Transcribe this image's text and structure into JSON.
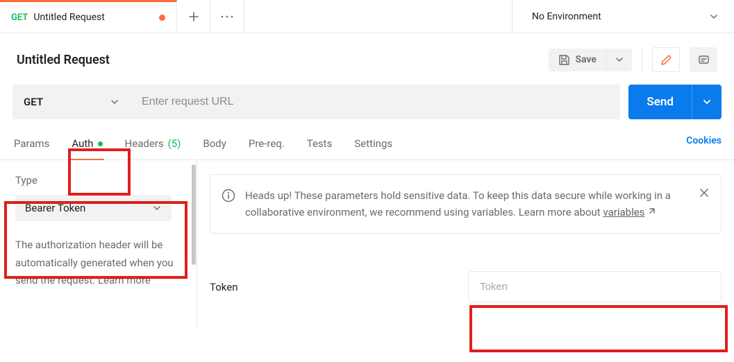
{
  "topbar": {
    "tab": {
      "method": "GET",
      "name": "Untitled Request"
    },
    "env": "No Environment"
  },
  "header": {
    "title": "Untitled Request",
    "save_label": "Save"
  },
  "urlbar": {
    "method": "GET",
    "url_placeholder": "Enter request URL",
    "send_label": "Send"
  },
  "tabs": {
    "params": "Params",
    "auth": "Auth",
    "headers": "Headers",
    "headers_count": "(5)",
    "body": "Body",
    "prereq": "Pre-req.",
    "tests": "Tests",
    "settings": "Settings",
    "cookies": "Cookies"
  },
  "sidebar": {
    "type_label": "Type",
    "type_value": "Bearer Token",
    "auth_desc": "The authorization header will be automatically generated when you send the request. Learn more"
  },
  "banner": {
    "text": "Heads up! These parameters hold sensitive data. To keep this data secure while working in a collaborative environment, we recommend using variables. Learn more about ",
    "link_text": "variables"
  },
  "token": {
    "label": "Token",
    "placeholder": "Token"
  }
}
